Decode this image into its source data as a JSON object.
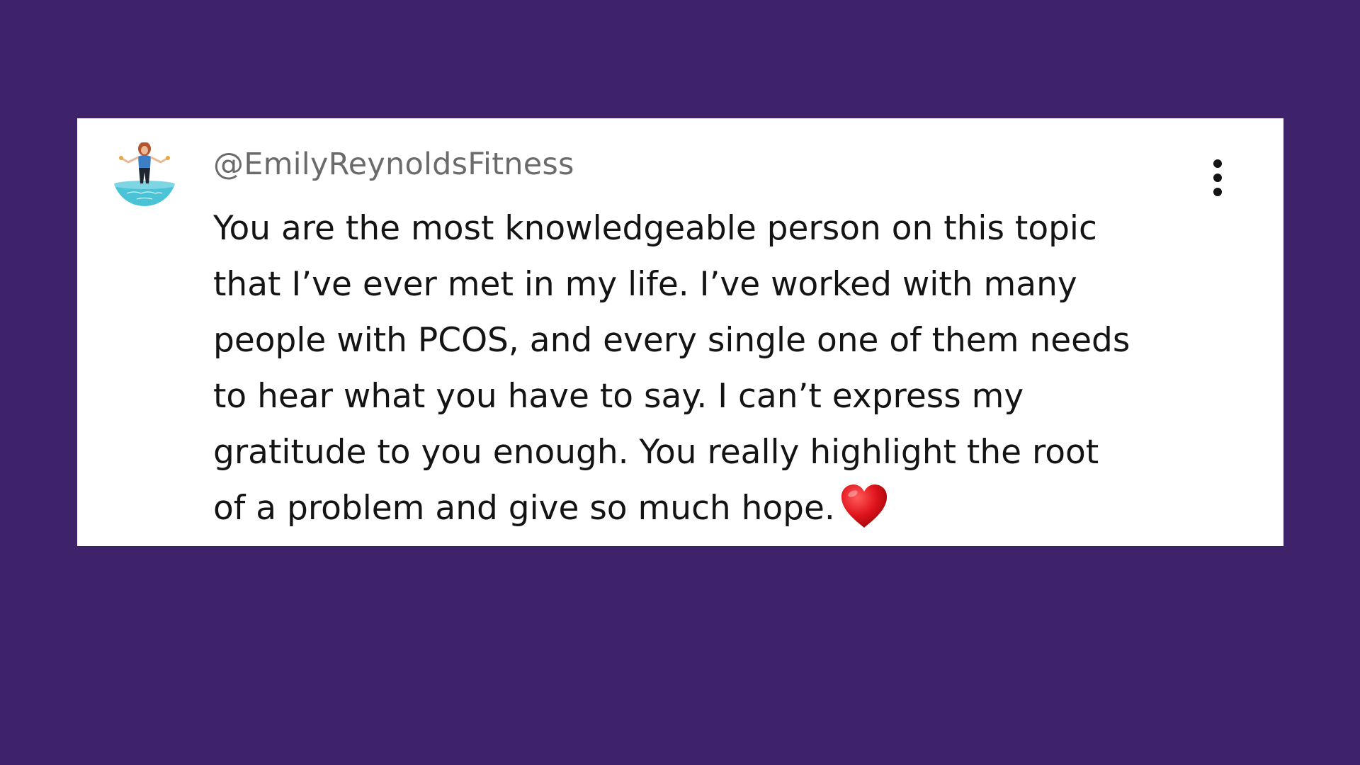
{
  "comment": {
    "username": "@EmilyReynoldsFitness",
    "lines": [
      "You are the most knowledgeable person on this topic",
      "that I’ve ever met in my life. I’ve worked with many",
      "people with PCOS, and every single one of them needs",
      "to hear what you have to say. I can’t express my",
      "gratitude to you enough. You really highlight the root",
      "of a problem and give so much hope."
    ],
    "emoji": "heart-icon",
    "avatar_icon": "profile-avatar",
    "menu_icon": "more-vertical-icon"
  },
  "colors": {
    "background": "#3e236a",
    "card": "#ffffff",
    "username": "#6b6b6b",
    "text": "#141414",
    "heart": "#e0141c",
    "avatar_accent": "#4bc3d6"
  }
}
